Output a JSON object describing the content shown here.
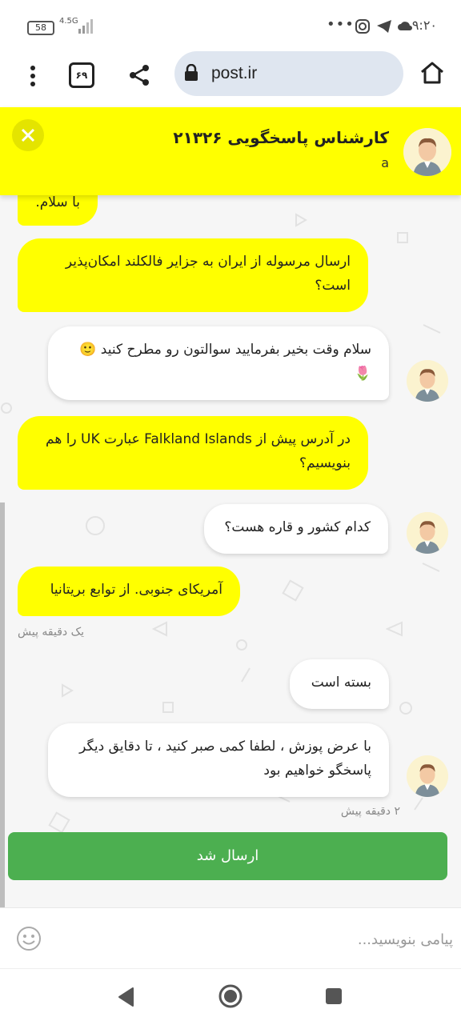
{
  "status_bar": {
    "time": "۹:۲۰",
    "battery": "58",
    "network": "4.5G",
    "more": "•••"
  },
  "browser": {
    "url": "post.ir",
    "tab_count": "۶۹"
  },
  "chat_header": {
    "title": "کارشناس پاسخگویی ۲۱۳۲۶",
    "subtitle": "a"
  },
  "messages": [
    {
      "sender": "user",
      "text": "با سلام."
    },
    {
      "sender": "user",
      "text": "ارسال مرسوله از ایران به جزایر فالکلند امکان‌پذیر است؟"
    },
    {
      "sender": "agent",
      "text": "سلام وقت بخیر بفرمایید سوالتون رو مطرح کنید 🙂🌷"
    },
    {
      "sender": "user",
      "text": "در آدرس پیش از Falkland Islands عبارت UK را هم بنویسیم؟"
    },
    {
      "sender": "agent",
      "text": "کدام کشور و قاره هست؟"
    },
    {
      "sender": "user",
      "text": "آمریکای جنوبی. از توابع بریتانیا"
    },
    {
      "sender": "agent",
      "text": "بسته است"
    },
    {
      "sender": "agent",
      "text": "با عرض پوزش ، لطفا کمی صبر کنید ، تا دقایق دیگر پاسخگو خواهیم بود"
    }
  ],
  "timestamps": {
    "user_last": "یک دقیقه پیش",
    "agent_last": "۲ دقیقه پیش"
  },
  "sent_banner": "ارسال شد",
  "composer": {
    "placeholder": "پیامی بنویسید..."
  },
  "colors": {
    "accent_yellow": "#ffff00",
    "success_green": "#4caf50"
  }
}
